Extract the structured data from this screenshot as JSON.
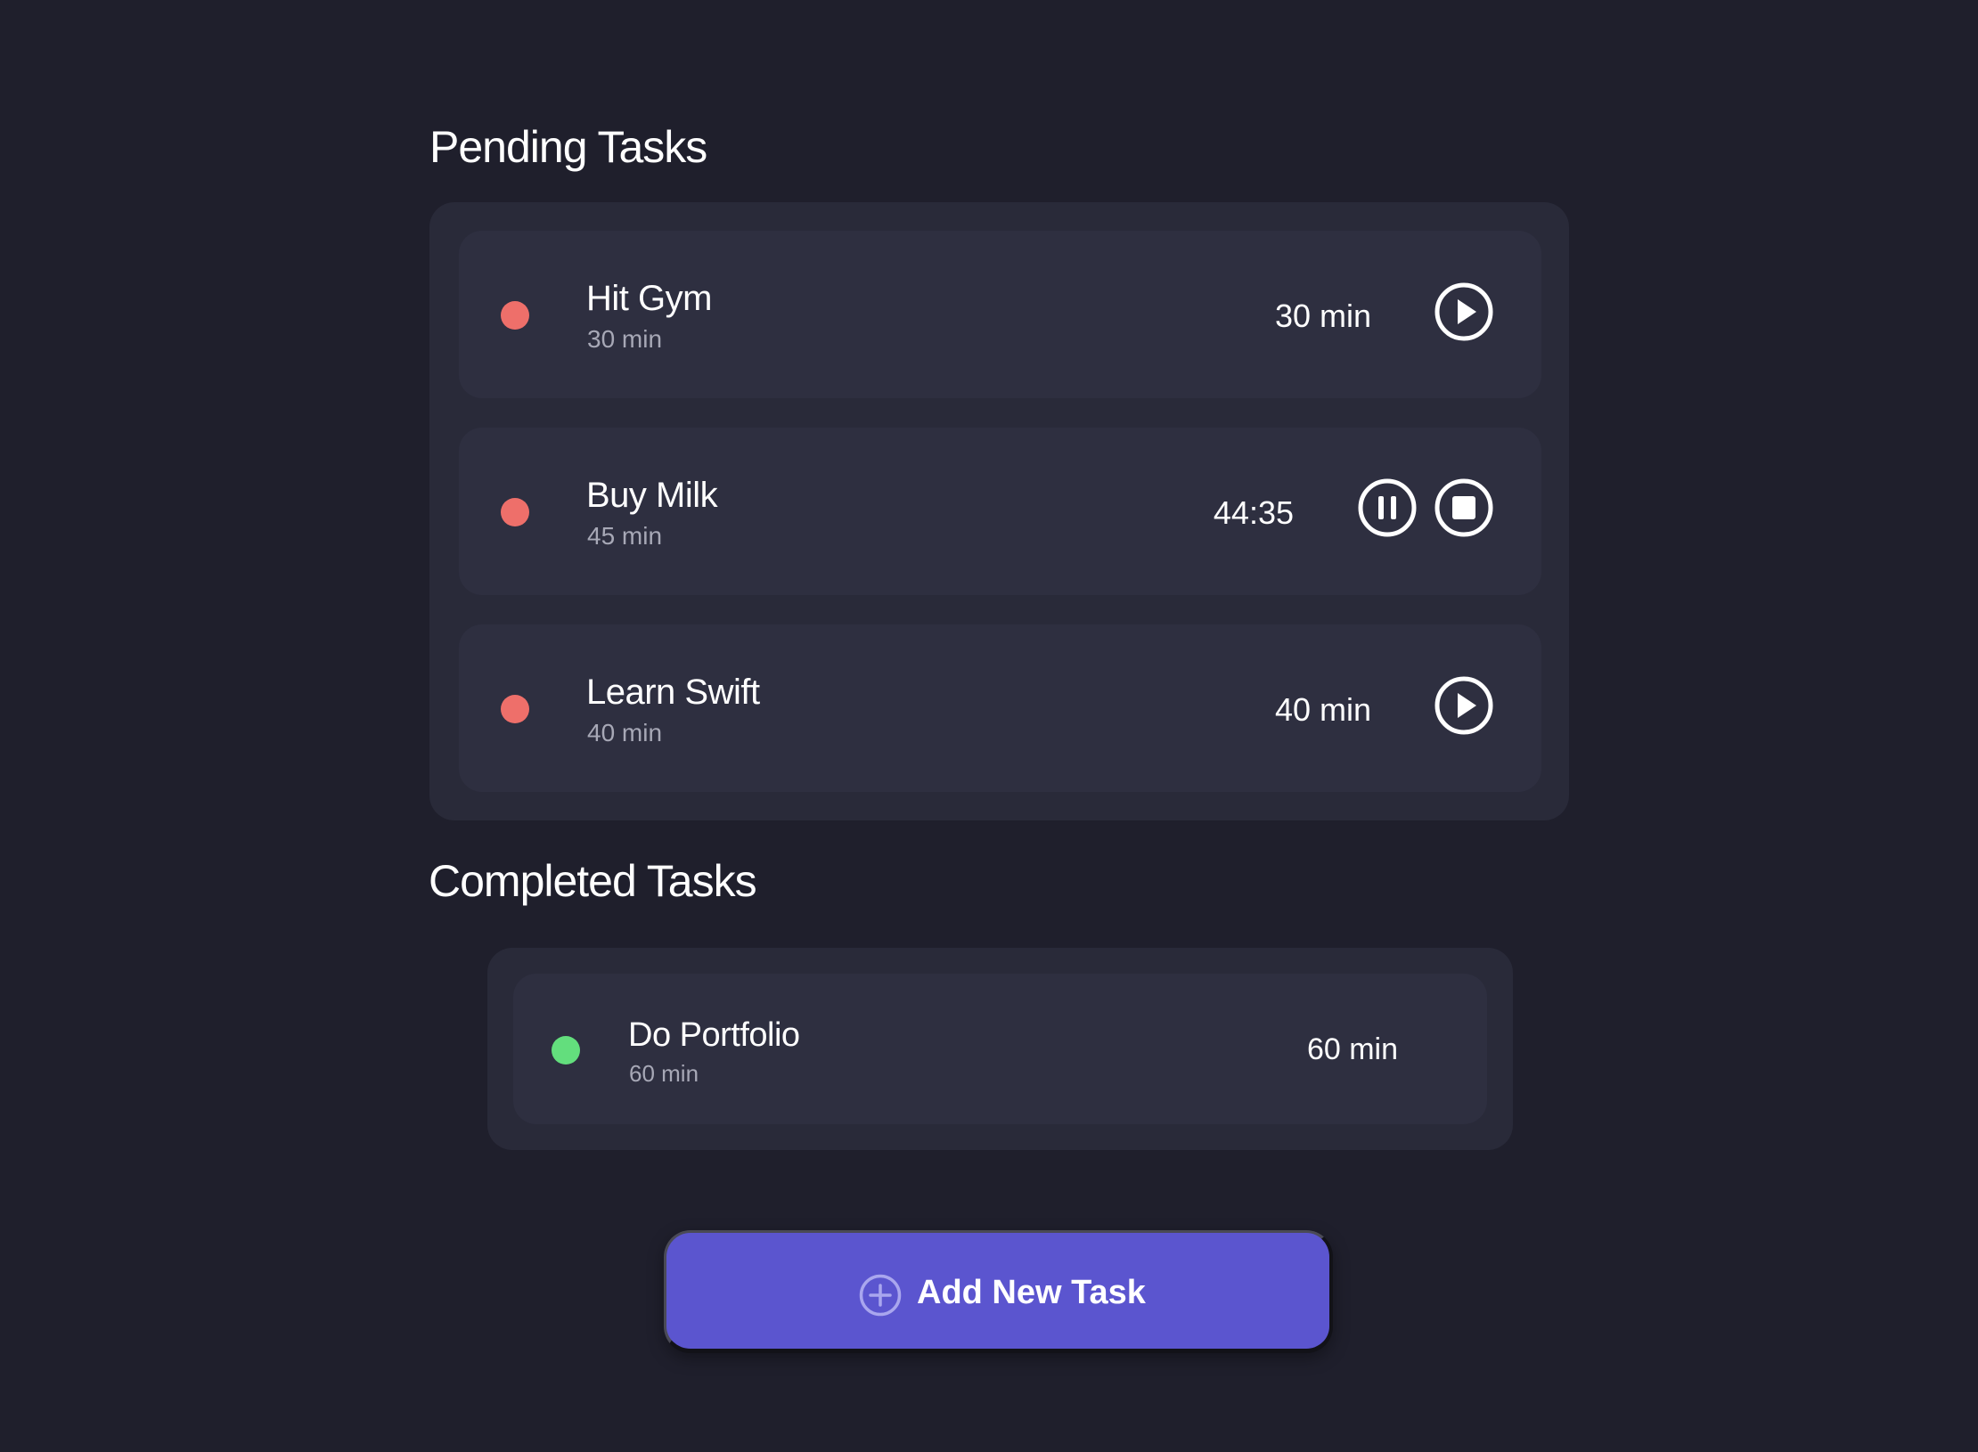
{
  "colors": {
    "background": "#1f1f2c",
    "panel": "#292a39",
    "card": "#2e2f40",
    "pending_dot": "#ee6f6a",
    "completed_dot": "#63de7d",
    "accent_button": "#5b55cf"
  },
  "pending": {
    "title": "Pending Tasks",
    "tasks": [
      {
        "name": "Hit Gym",
        "subtitle": "30 min",
        "time": "30 min",
        "controls": [
          "play-icon"
        ]
      },
      {
        "name": "Buy Milk",
        "subtitle": "45 min",
        "time": "44:35",
        "controls": [
          "pause-icon",
          "stop-icon"
        ]
      },
      {
        "name": "Learn Swift",
        "subtitle": "40 min",
        "time": "40 min",
        "controls": [
          "play-icon"
        ]
      }
    ]
  },
  "completed": {
    "title": "Completed Tasks",
    "tasks": [
      {
        "name": "Do Portfolio",
        "subtitle": "60 min",
        "time": "60 min"
      }
    ]
  },
  "add_button": {
    "label": "Add New Task",
    "icon": "plus-circle-icon"
  }
}
